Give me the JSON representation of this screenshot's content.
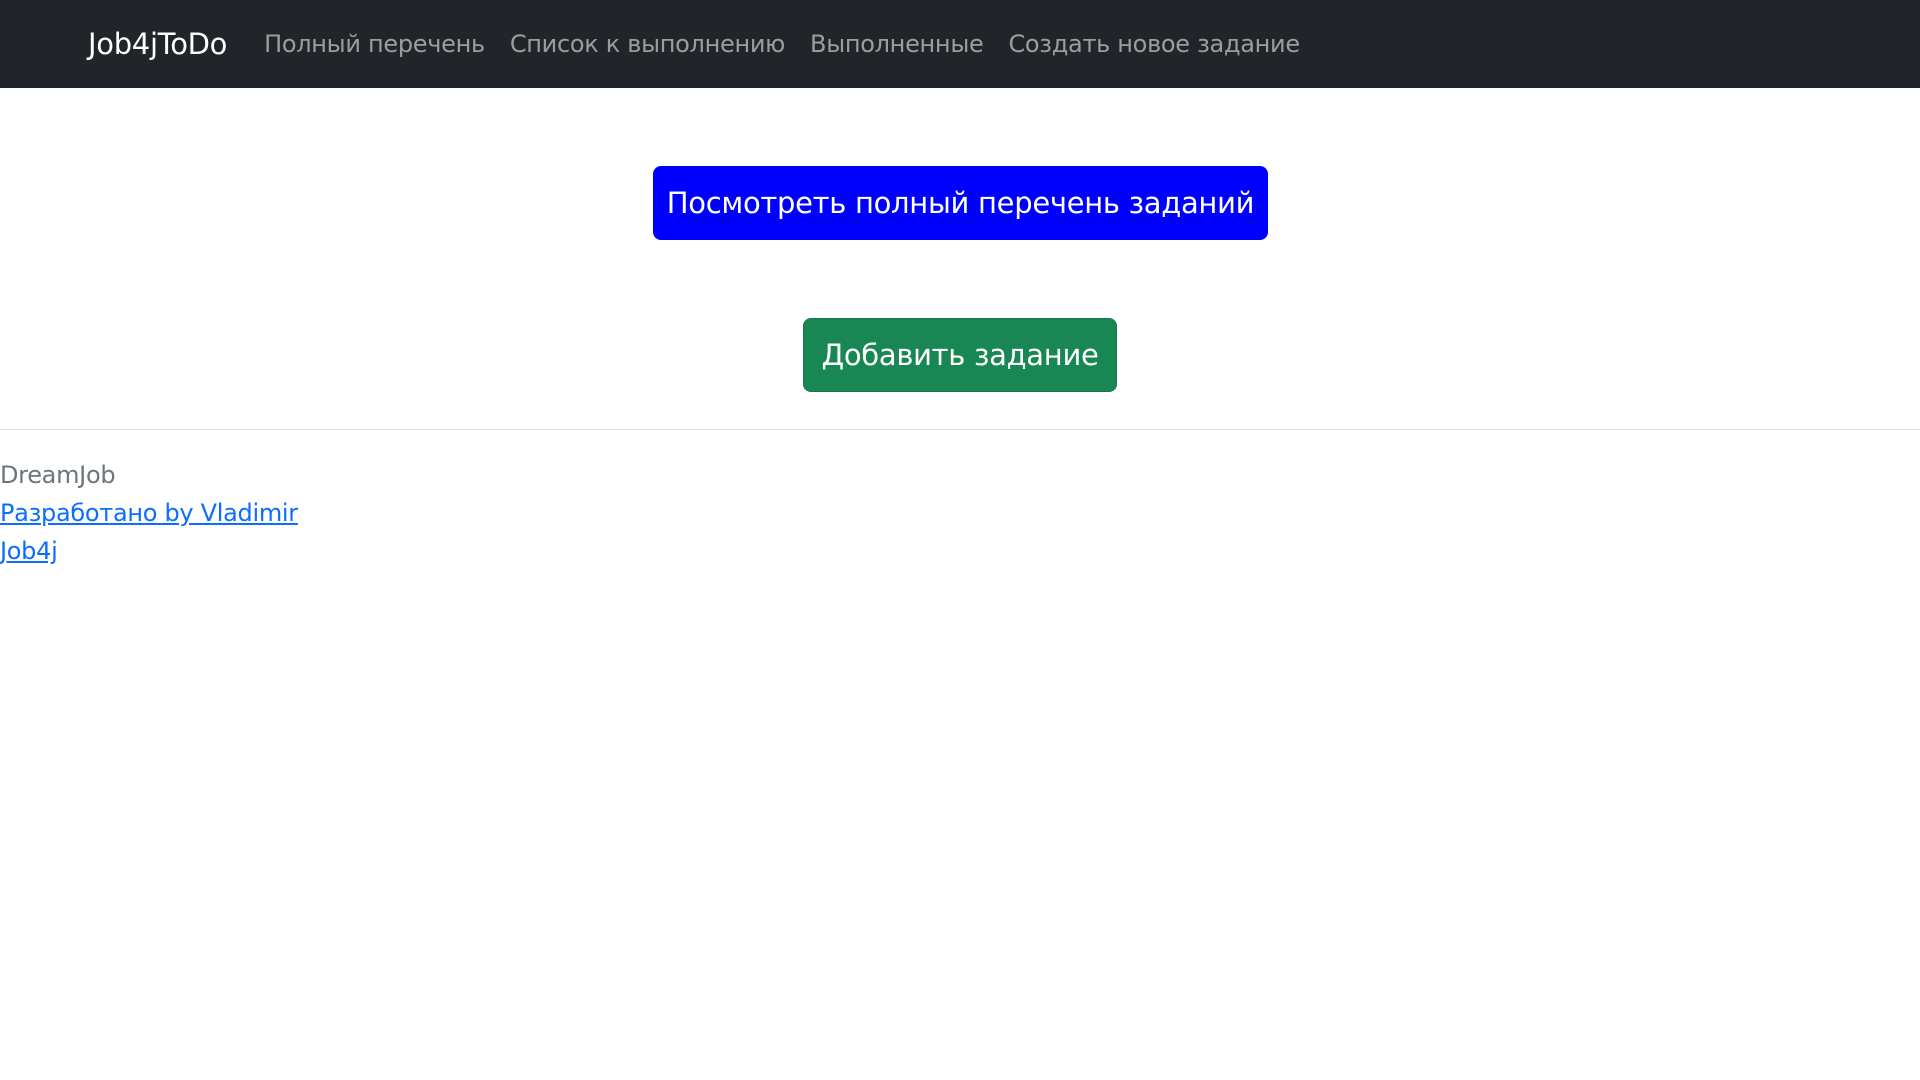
{
  "navbar": {
    "brand": "Job4jToDo",
    "links": [
      {
        "label": "Полный перечень"
      },
      {
        "label": "Список к выполнению"
      },
      {
        "label": "Выполненные"
      },
      {
        "label": "Создать новое задание"
      }
    ],
    "background_color": "#212529"
  },
  "main": {
    "view_all_button": "Посмотреть полный перечень заданий",
    "add_task_button": "Добавить задание",
    "colors": {
      "primary": "#0000ff",
      "success": "#198754"
    }
  },
  "footer": {
    "company": "DreamJob",
    "developer_link": "Разработано by Vladimir",
    "org_link": "Job4j",
    "link_color": "#0d6efd"
  }
}
